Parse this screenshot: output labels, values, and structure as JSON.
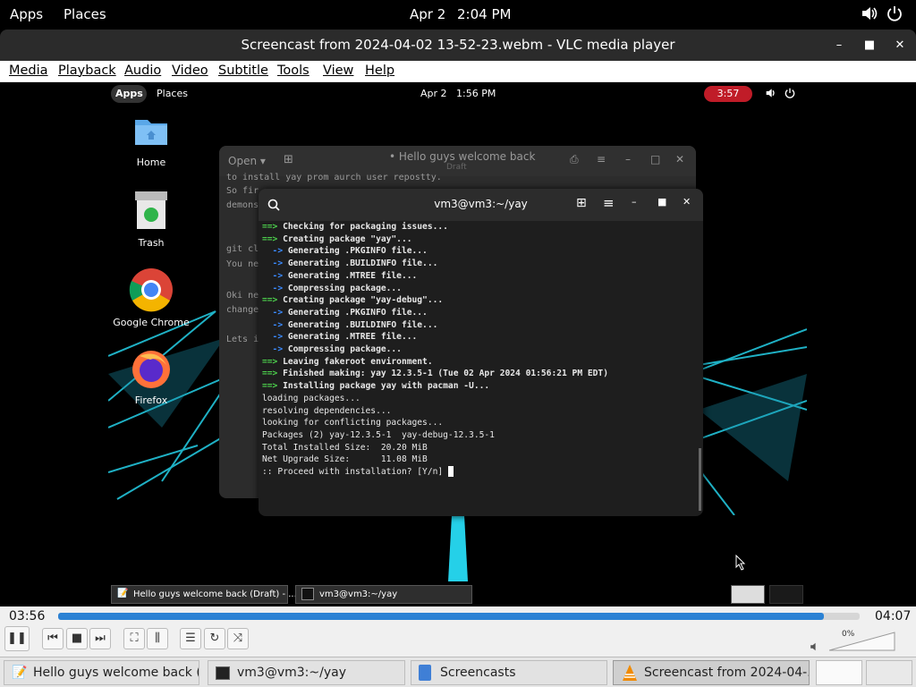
{
  "topbar": {
    "apps": "Apps",
    "places": "Places",
    "date": "Apr 2",
    "time": "2:04 PM"
  },
  "vlc": {
    "title": "Screencast from 2024-04-02 13-52-23.webm - VLC media player",
    "menu": [
      "Media",
      "Playback",
      "Audio",
      "Video",
      "Subtitle",
      "Tools",
      "View",
      "Help"
    ],
    "elapsed": "03:56",
    "total": "04:07",
    "progress": 0.955,
    "volume_label": "0%"
  },
  "inner": {
    "apps": "Apps",
    "places": "Places",
    "date": "Apr 2",
    "time": "1:56 PM",
    "record_time": "3:57",
    "icons": [
      "Home",
      "Trash",
      "Google Chrome",
      "Firefox"
    ],
    "editor": {
      "open": "Open",
      "title": "• Hello guys welcome back",
      "subtitle": "Draft",
      "lines": [
        "to install yay prom aurch user repostty.",
        "So fir",
        "demons",
        "git cl",
        "You ne",
        "Oki ne",
        "change",
        "Lets i"
      ]
    },
    "terminal": {
      "title": "vm3@vm3:~/yay",
      "lines": [
        {
          "p": "==>",
          "t": " Checking for packaging issues...",
          "c": "grn"
        },
        {
          "p": "==>",
          "t": " Creating package \"yay\"...",
          "c": "grn"
        },
        {
          "p": "  ->",
          "t": " Generating .PKGINFO file...",
          "c": "arr"
        },
        {
          "p": "  ->",
          "t": " Generating .BUILDINFO file...",
          "c": "arr"
        },
        {
          "p": "  ->",
          "t": " Generating .MTREE file...",
          "c": "arr"
        },
        {
          "p": "  ->",
          "t": " Compressing package...",
          "c": "arr"
        },
        {
          "p": "==>",
          "t": " Creating package \"yay-debug\"...",
          "c": "grn"
        },
        {
          "p": "  ->",
          "t": " Generating .PKGINFO file...",
          "c": "arr"
        },
        {
          "p": "  ->",
          "t": " Generating .BUILDINFO file...",
          "c": "arr"
        },
        {
          "p": "  ->",
          "t": " Generating .MTREE file...",
          "c": "arr"
        },
        {
          "p": "  ->",
          "t": " Compressing package...",
          "c": "arr"
        },
        {
          "p": "==>",
          "t": " Leaving fakeroot environment.",
          "c": "grn"
        },
        {
          "p": "==>",
          "t": " Finished making: yay 12.3.5-1 (Tue 02 Apr 2024 01:56:21 PM EDT)",
          "c": "grn"
        },
        {
          "p": "==>",
          "t": " Installing package yay with pacman -U...",
          "c": "grn"
        },
        {
          "p": "",
          "t": "loading packages...",
          "c": ""
        },
        {
          "p": "",
          "t": "resolving dependencies...",
          "c": ""
        },
        {
          "p": "",
          "t": "looking for conflicting packages...",
          "c": ""
        },
        {
          "p": "",
          "t": "",
          "c": ""
        },
        {
          "p": "",
          "t": "Packages (2) yay-12.3.5-1  yay-debug-12.3.5-1",
          "c": ""
        },
        {
          "p": "",
          "t": "",
          "c": ""
        },
        {
          "p": "",
          "t": "Total Installed Size:  20.20 MiB",
          "c": ""
        },
        {
          "p": "",
          "t": "Net Upgrade Size:      11.08 MiB",
          "c": ""
        },
        {
          "p": "",
          "t": "",
          "c": ""
        },
        {
          "p": "",
          "t": ":: Proceed with installation? [Y/n] ",
          "c": ""
        }
      ]
    },
    "taskbar": [
      "Hello guys welcome back (Draft) - ...",
      "vm3@vm3:~/yay"
    ]
  },
  "taskbar": [
    "Hello guys welcome back (...",
    "vm3@vm3:~/yay",
    "Screencasts",
    "Screencast from 2024-04-..."
  ]
}
